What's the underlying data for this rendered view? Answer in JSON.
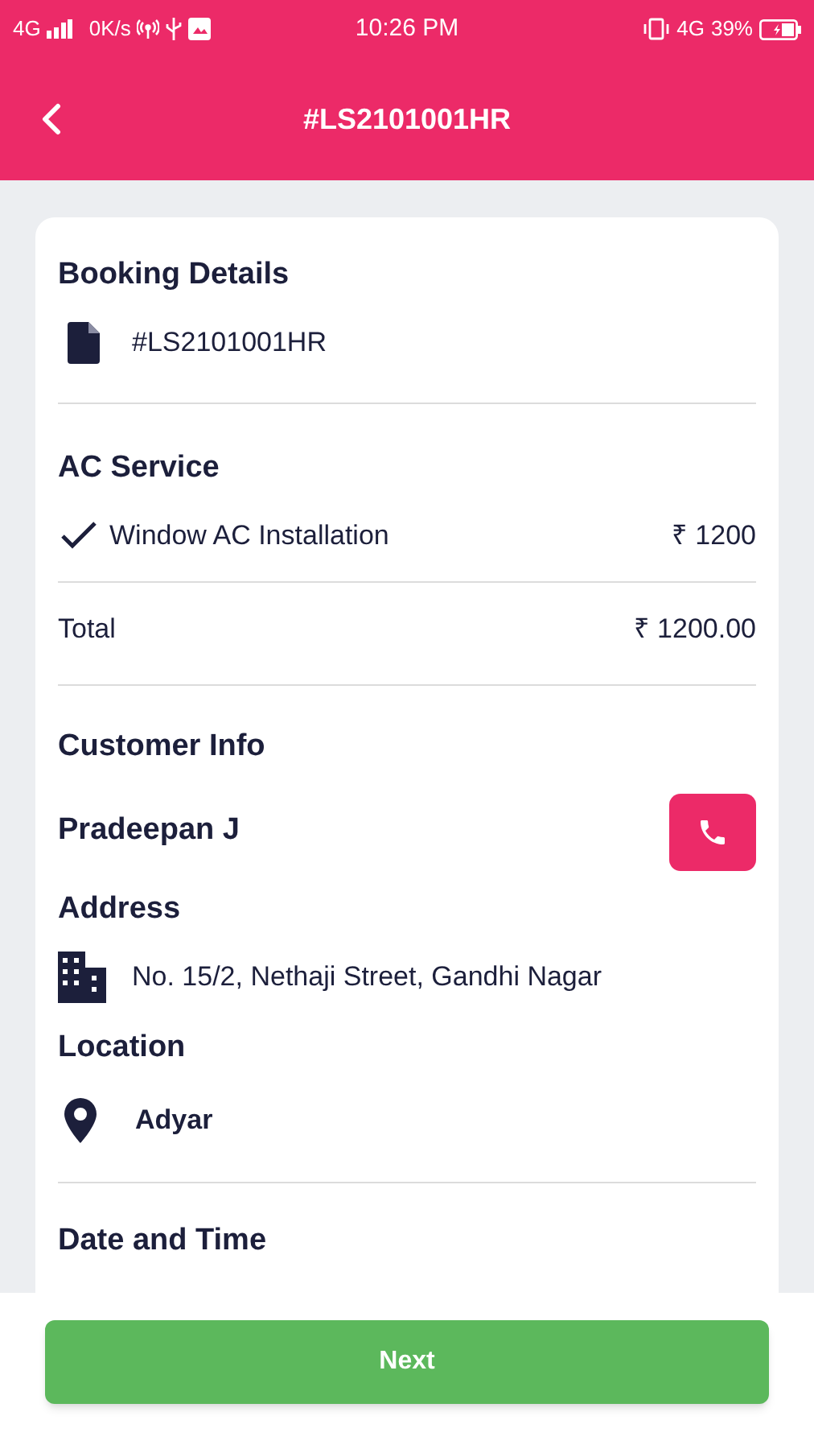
{
  "status_bar": {
    "network": "4G",
    "speed": "0K/s",
    "time": "10:26 PM",
    "data_network": "4G",
    "battery": "39%"
  },
  "header": {
    "title": "#LS2101001HR"
  },
  "booking": {
    "heading": "Booking Details",
    "id": "#LS2101001HR"
  },
  "service": {
    "heading": "AC Service",
    "items": [
      {
        "name": "Window AC Installation",
        "price": "₹ 1200",
        "checked": true
      }
    ],
    "total_label": "Total",
    "total": "₹ 1200.00"
  },
  "customer": {
    "heading": "Customer Info",
    "name": "Pradeepan J"
  },
  "address": {
    "heading": "Address",
    "text": "No. 15/2, Nethaji Street, Gandhi Nagar"
  },
  "location": {
    "heading": "Location",
    "text": "Adyar"
  },
  "date_time": {
    "heading": "Date and Time"
  },
  "footer": {
    "button": "Next"
  }
}
